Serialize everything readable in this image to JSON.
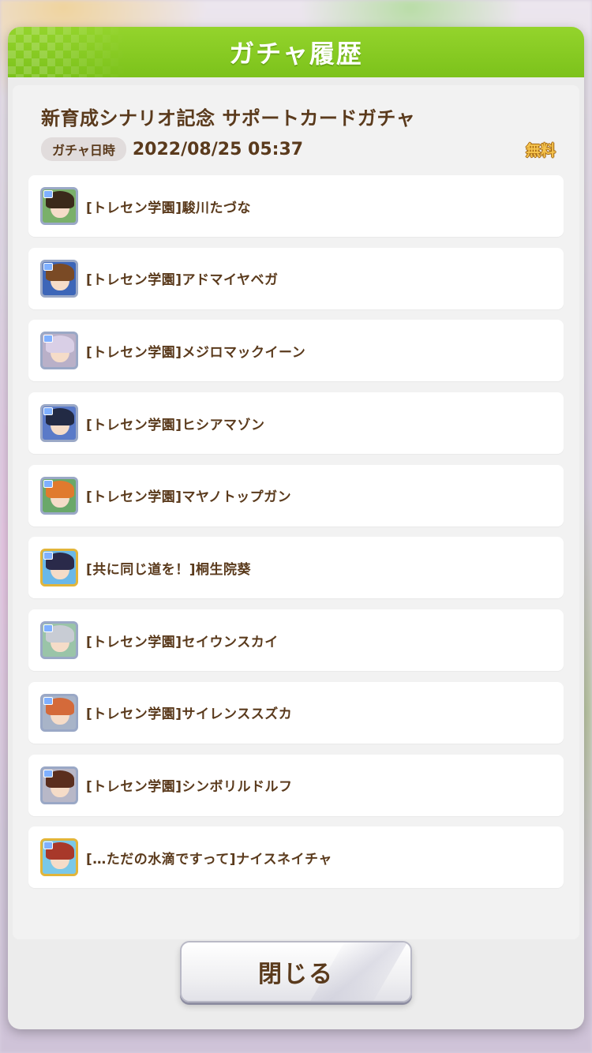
{
  "modal": {
    "title": "ガチャ履歴",
    "gacha_name": "新育成シナリオ記念 サポートカードガチャ",
    "date_tag": "ガチャ日時",
    "date_value": "2022/08/25 05:37",
    "cost_label": "無料",
    "close_label": "閉じる"
  },
  "results": [
    {
      "label": "[トレセン学園]駿川たづな",
      "rarity": "R",
      "hair": "#3a2a1a",
      "bg": "#7ab06a"
    },
    {
      "label": "[トレセン学園]アドマイヤベガ",
      "rarity": "R",
      "hair": "#7a4a25",
      "bg": "#3d66b8"
    },
    {
      "label": "[トレセン学園]メジロマックイーン",
      "rarity": "R",
      "hair": "#d9cfe6",
      "bg": "#b9b0c8"
    },
    {
      "label": "[トレセン学園]ヒシアマゾン",
      "rarity": "R",
      "hair": "#222a44",
      "bg": "#5a7ac8"
    },
    {
      "label": "[トレセン学園]マヤノトップガン",
      "rarity": "R",
      "hair": "#e07a2e",
      "bg": "#6aa86a"
    },
    {
      "label": "[共に同じ道を！]桐生院葵",
      "rarity": "SSR",
      "hair": "#2a2a4a",
      "bg": "#6ab8e8"
    },
    {
      "label": "[トレセン学園]セイウンスカイ",
      "rarity": "R",
      "hair": "#c8ccd4",
      "bg": "#9ac4a8"
    },
    {
      "label": "[トレセン学園]サイレンススズカ",
      "rarity": "R",
      "hair": "#d46a3a",
      "bg": "#a8b4c8"
    },
    {
      "label": "[トレセン学園]シンボリルドルフ",
      "rarity": "R",
      "hair": "#5a2e1e",
      "bg": "#b8b8c8"
    },
    {
      "label": "[…ただの水滴ですって]ナイスネイチャ",
      "rarity": "SSR",
      "hair": "#a8382a",
      "bg": "#7ac8e8"
    }
  ],
  "colors": {
    "header_green": "#86cb22",
    "text_brown": "#5a3a1c",
    "free_gold": "#f5c34d",
    "frame_blue": "#9aa8c6",
    "frame_gold": "#e2b53a"
  }
}
